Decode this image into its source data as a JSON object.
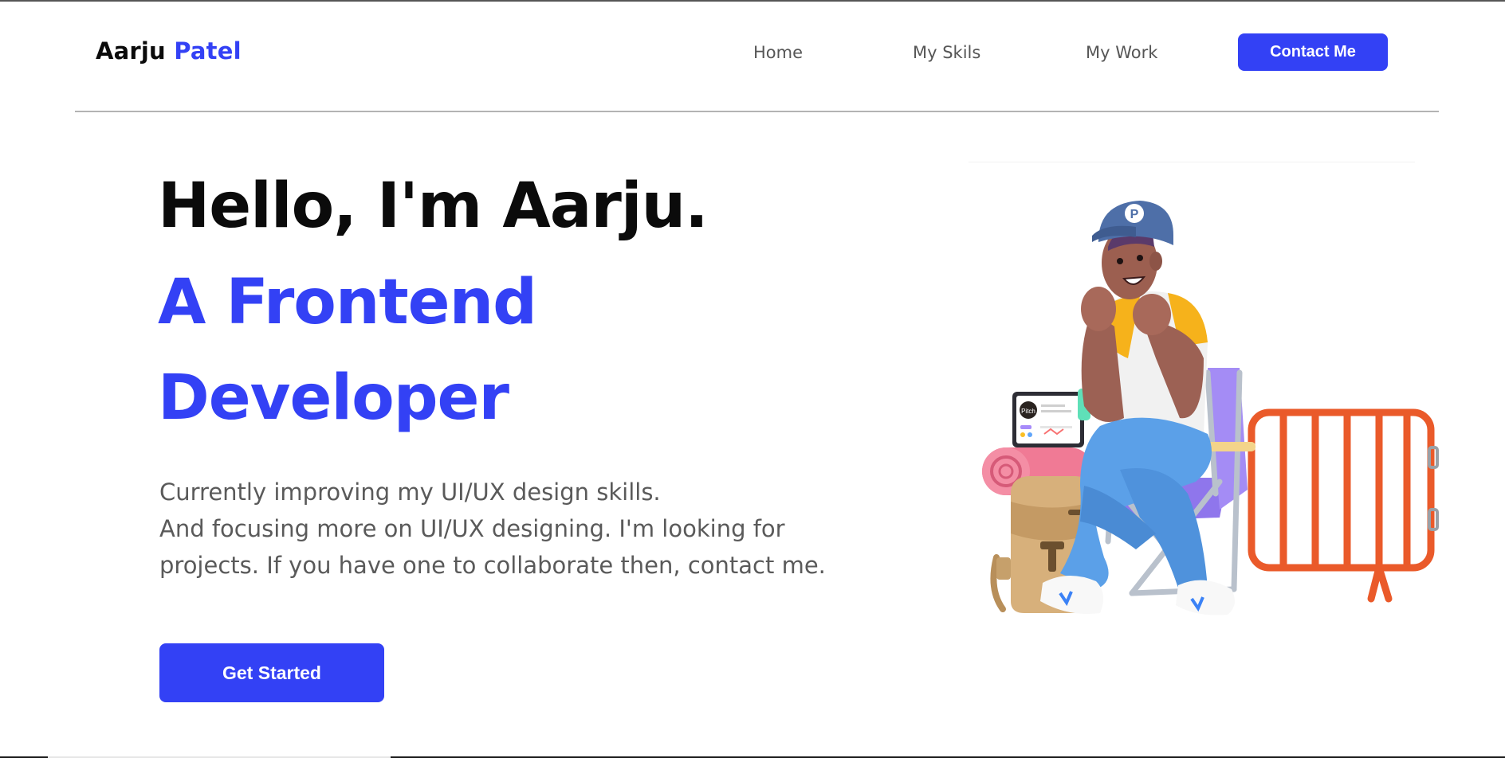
{
  "header": {
    "logo_first": "Aarju",
    "logo_last": "Patel",
    "nav": {
      "home": "Home",
      "skills": "My Skils",
      "work": "My Work"
    },
    "contact_label": "Contact Me"
  },
  "hero": {
    "greeting": "Hello, I'm Aarju.",
    "role_line1": "A Frontend",
    "role_line2": "Developer",
    "desc_line1": "Currently improving my UI/UX design skills.",
    "desc_line2": "And focusing more on UI/UX designing. I'm looking for",
    "desc_line3": "projects. If you have one to collaborate then, contact me.",
    "cta_label": "Get Started"
  },
  "illustration": {
    "cap_letter": "P",
    "tablet_logo": "Pitch"
  },
  "colors": {
    "accent": "#3341f5",
    "heading": "#0b0b0b",
    "body_text": "#5a5a5a",
    "nav_text": "#565656"
  }
}
